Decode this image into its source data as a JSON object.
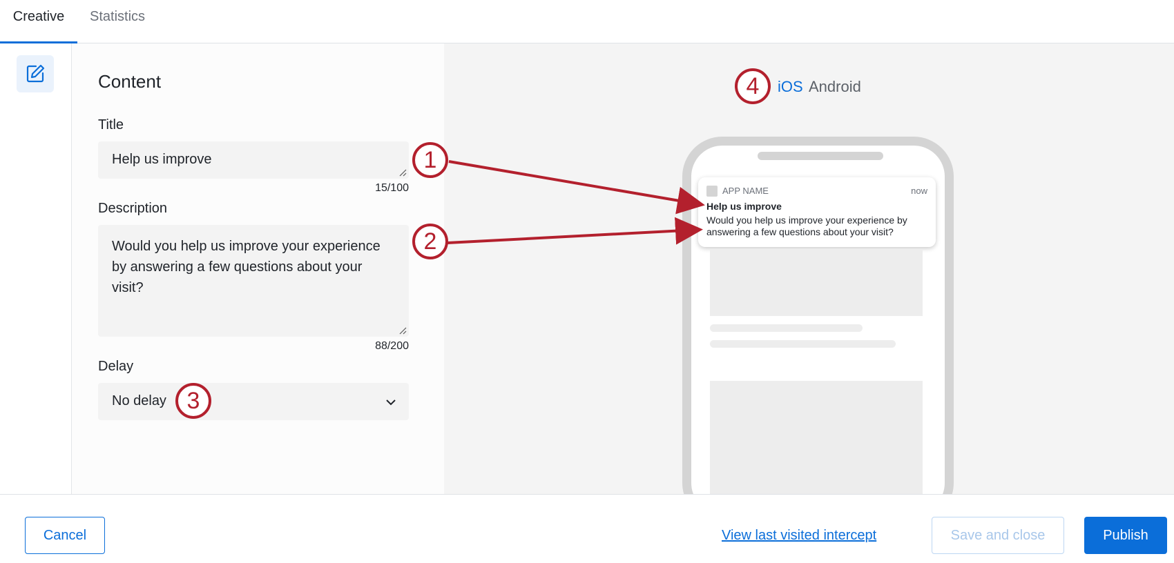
{
  "tabs": {
    "creative": "Creative",
    "statistics": "Statistics"
  },
  "rail": {
    "edit_icon": "edit-icon"
  },
  "content": {
    "heading": "Content",
    "title_label": "Title",
    "title_value": "Help us improve",
    "title_counter": "15/100",
    "description_label": "Description",
    "description_value": "Would you help us improve your experience by answering a few questions about your visit?",
    "description_counter": "88/200",
    "delay_label": "Delay",
    "delay_value": "No delay"
  },
  "preview": {
    "os_tabs": [
      "iOS",
      "Android"
    ],
    "selected_os": "iOS",
    "notification": {
      "app_name": "APP NAME",
      "time": "now",
      "title": "Help us improve",
      "body": "Would you help us improve your experience by answering a few questions about your visit?"
    }
  },
  "callouts": [
    "1",
    "2",
    "3",
    "4"
  ],
  "footer": {
    "cancel": "Cancel",
    "view_intercept": "View last visited intercept",
    "save_close": "Save and close",
    "publish": "Publish"
  },
  "colors": {
    "accent": "#0b6ed9",
    "callout": "#b3202d",
    "disabled": "#a8c7ea"
  }
}
